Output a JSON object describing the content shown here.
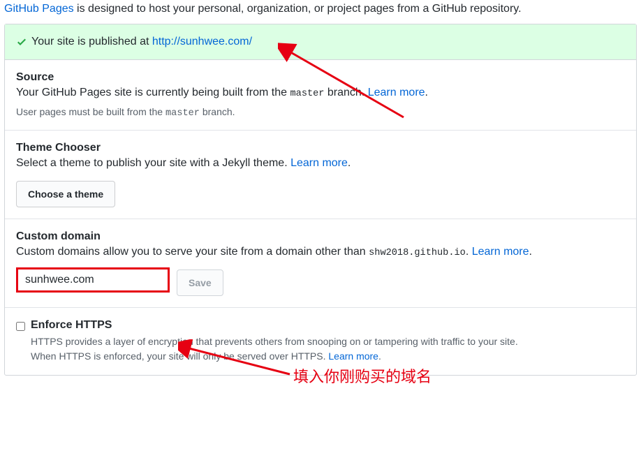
{
  "intro": {
    "link": "GitHub Pages",
    "text": " is designed to host your personal, organization, or project pages from a GitHub repository."
  },
  "flash": {
    "prefix": "Your site is published at ",
    "url": "http://sunhwee.com/"
  },
  "source": {
    "heading": "Source",
    "desc_prefix": "Your GitHub Pages site is currently being built from the ",
    "branch": "master",
    "desc_suffix": " branch. ",
    "learn_more": "Learn more",
    "note_prefix": "User pages must be built from the ",
    "note_branch": "master",
    "note_suffix": " branch."
  },
  "theme": {
    "heading": "Theme Chooser",
    "desc": "Select a theme to publish your site with a Jekyll theme. ",
    "learn_more": "Learn more",
    "button": "Choose a theme"
  },
  "custom_domain": {
    "heading": "Custom domain",
    "desc_prefix": "Custom domains allow you to serve your site from a domain other than ",
    "default_domain": "shw2018.github.io",
    "desc_suffix": ". ",
    "learn_more": "Learn more",
    "input_value": "sunhwee.com",
    "save": "Save"
  },
  "https": {
    "heading": "Enforce HTTPS",
    "line1": "HTTPS provides a layer of encryption that prevents others from snooping on or tampering with traffic to your site.",
    "line2_prefix": "When HTTPS is enforced, your site will only be served over HTTPS. ",
    "learn_more": "Learn more"
  },
  "annotation": {
    "text": "填入你刚购买的域名"
  }
}
